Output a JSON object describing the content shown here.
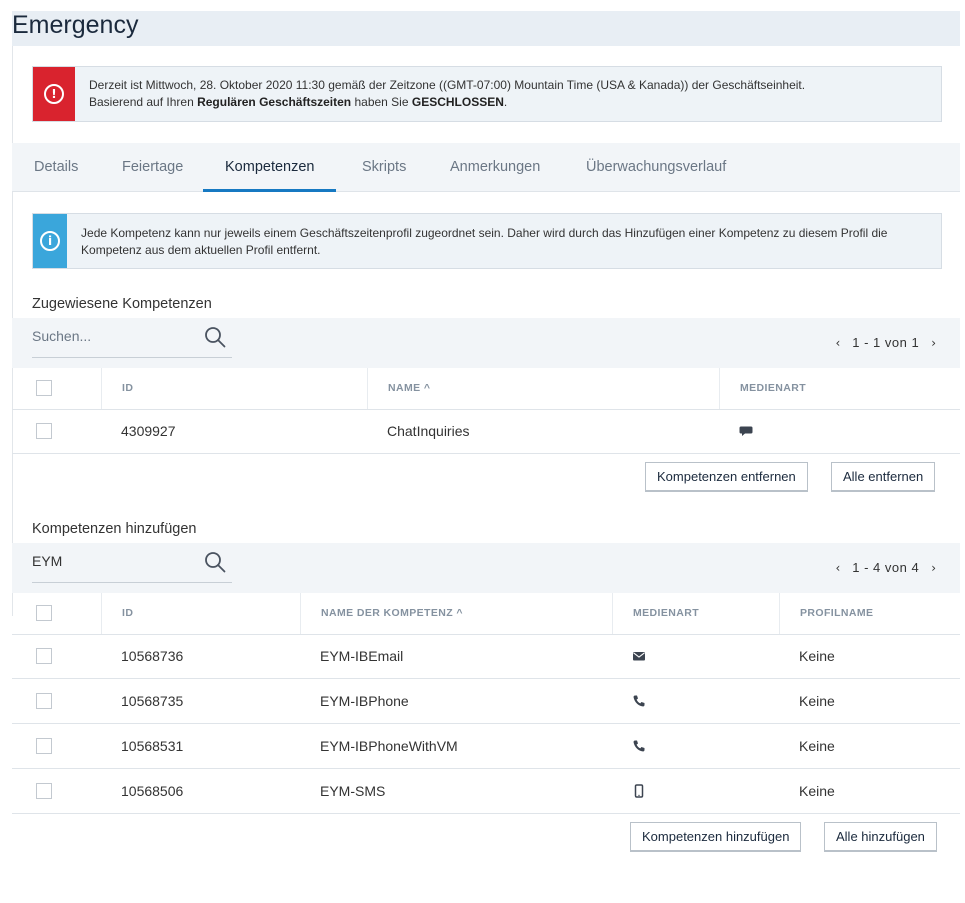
{
  "page": {
    "title": "Emergency"
  },
  "alert_error": {
    "line1": "Derzeit ist Mittwoch, 28. Oktober 2020 11:30 gemäß der Zeitzone ((GMT-07:00) Mountain Time (USA & Kanada)) der Geschäftseinheit.",
    "line2_prefix": "Basierend auf Ihren ",
    "line2_bold1": "Regulären Geschäftszeiten",
    "line2_mid": " haben Sie ",
    "line2_bold2": "GESCHLOSSEN",
    "line2_suffix": ".",
    "icon": "alert-circle-icon",
    "color": "#d9232e"
  },
  "tabs": [
    {
      "label": "Details",
      "active": false
    },
    {
      "label": "Feiertage",
      "active": false
    },
    {
      "label": "Kompetenzen",
      "active": true
    },
    {
      "label": "Skripts",
      "active": false
    },
    {
      "label": "Anmerkungen",
      "active": false
    },
    {
      "label": "Überwachungsverlauf",
      "active": false
    }
  ],
  "alert_info": {
    "text": "Jede Kompetenz kann nur jeweils einem Geschäftszeitenprofil zugeordnet sein. Daher wird durch das Hinzufügen einer Kompetenz zu diesem Profil die Kompetenz aus dem aktuellen Profil entfernt.",
    "icon": "info-circle-icon",
    "color": "#3aa6db"
  },
  "assigned": {
    "title": "Zugewiesene Kompetenzen",
    "search_placeholder": "Suchen...",
    "search_value": "",
    "pager": "1 - 1 von 1",
    "columns": [
      "ID",
      "NAME ^",
      "MEDIENART"
    ],
    "rows": [
      {
        "id": "4309927",
        "name": "ChatInquiries",
        "media": "chat-icon"
      }
    ],
    "remove_button": "Kompetenzen entfernen",
    "remove_all_button": "Alle entfernen"
  },
  "add": {
    "title": "Kompetenzen hinzufügen",
    "search_placeholder": "Suchen...",
    "search_value": "EYM",
    "pager": "1 - 4 von 4",
    "columns": [
      "ID",
      "NAME DER KOMPETENZ ^",
      "MEDIENART",
      "PROFILNAME"
    ],
    "rows": [
      {
        "id": "10568736",
        "name": "EYM-IBEmail",
        "media": "email-icon",
        "profile": "Keine"
      },
      {
        "id": "10568735",
        "name": "EYM-IBPhone",
        "media": "phone-icon",
        "profile": "Keine"
      },
      {
        "id": "10568531",
        "name": "EYM-IBPhoneWithVM",
        "media": "phone-icon",
        "profile": "Keine"
      },
      {
        "id": "10568506",
        "name": "EYM-SMS",
        "media": "mobile-icon",
        "profile": "Keine"
      }
    ],
    "add_button": "Kompetenzen hinzufügen",
    "add_all_button": "Alle hinzufügen"
  },
  "colors": {
    "accent": "#1679c2",
    "header_bg": "#e8eef4"
  }
}
